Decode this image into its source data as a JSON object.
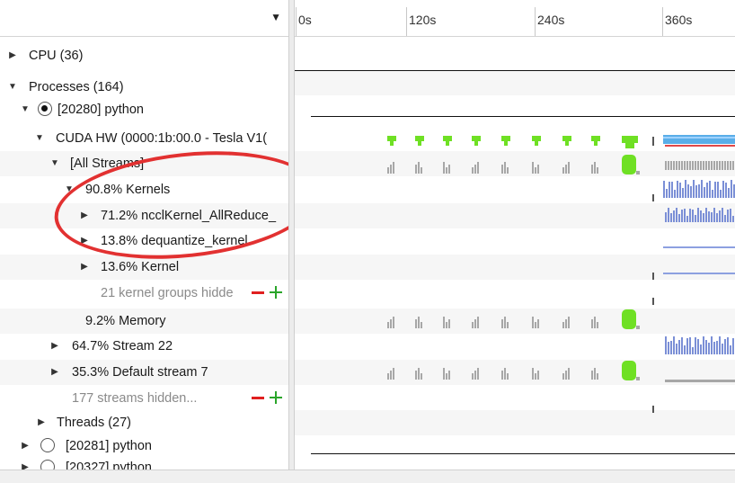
{
  "ruler": {
    "dropdown_icon": "caret-down-icon",
    "ticks": [
      "0s",
      "120s",
      "240s",
      "360s"
    ]
  },
  "tree": {
    "cpu": "CPU (36)",
    "processes": "Processes (164)",
    "process_main": "[20280] python",
    "cuda_hw": "CUDA HW (0000:1b:00.0 - Tesla V1(",
    "all_streams": "[All Streams]",
    "kernels": "90.8% Kernels",
    "nccl": "71.2% ncclKernel_AllReduce_",
    "dequantize": "13.8% dequantize_kernel",
    "kernel": "13.6% Kernel",
    "kernel_hidden": "21 kernel groups hidde",
    "memory": "9.2% Memory",
    "stream22": "64.7% Stream 22",
    "default_stream": "35.3% Default stream 7",
    "streams_hidden": "177 streams hidden...",
    "threads": "Threads (27)",
    "process_2": "[20281] python",
    "process_3": "[20327] python"
  },
  "colors": {
    "kernel_bar": "#7b8fd6",
    "memcpy_green": "#6fe024",
    "sparse_gray": "#a7a7a7",
    "cuda_blue": "#5aaee8",
    "annotation_red": "#e23131"
  }
}
